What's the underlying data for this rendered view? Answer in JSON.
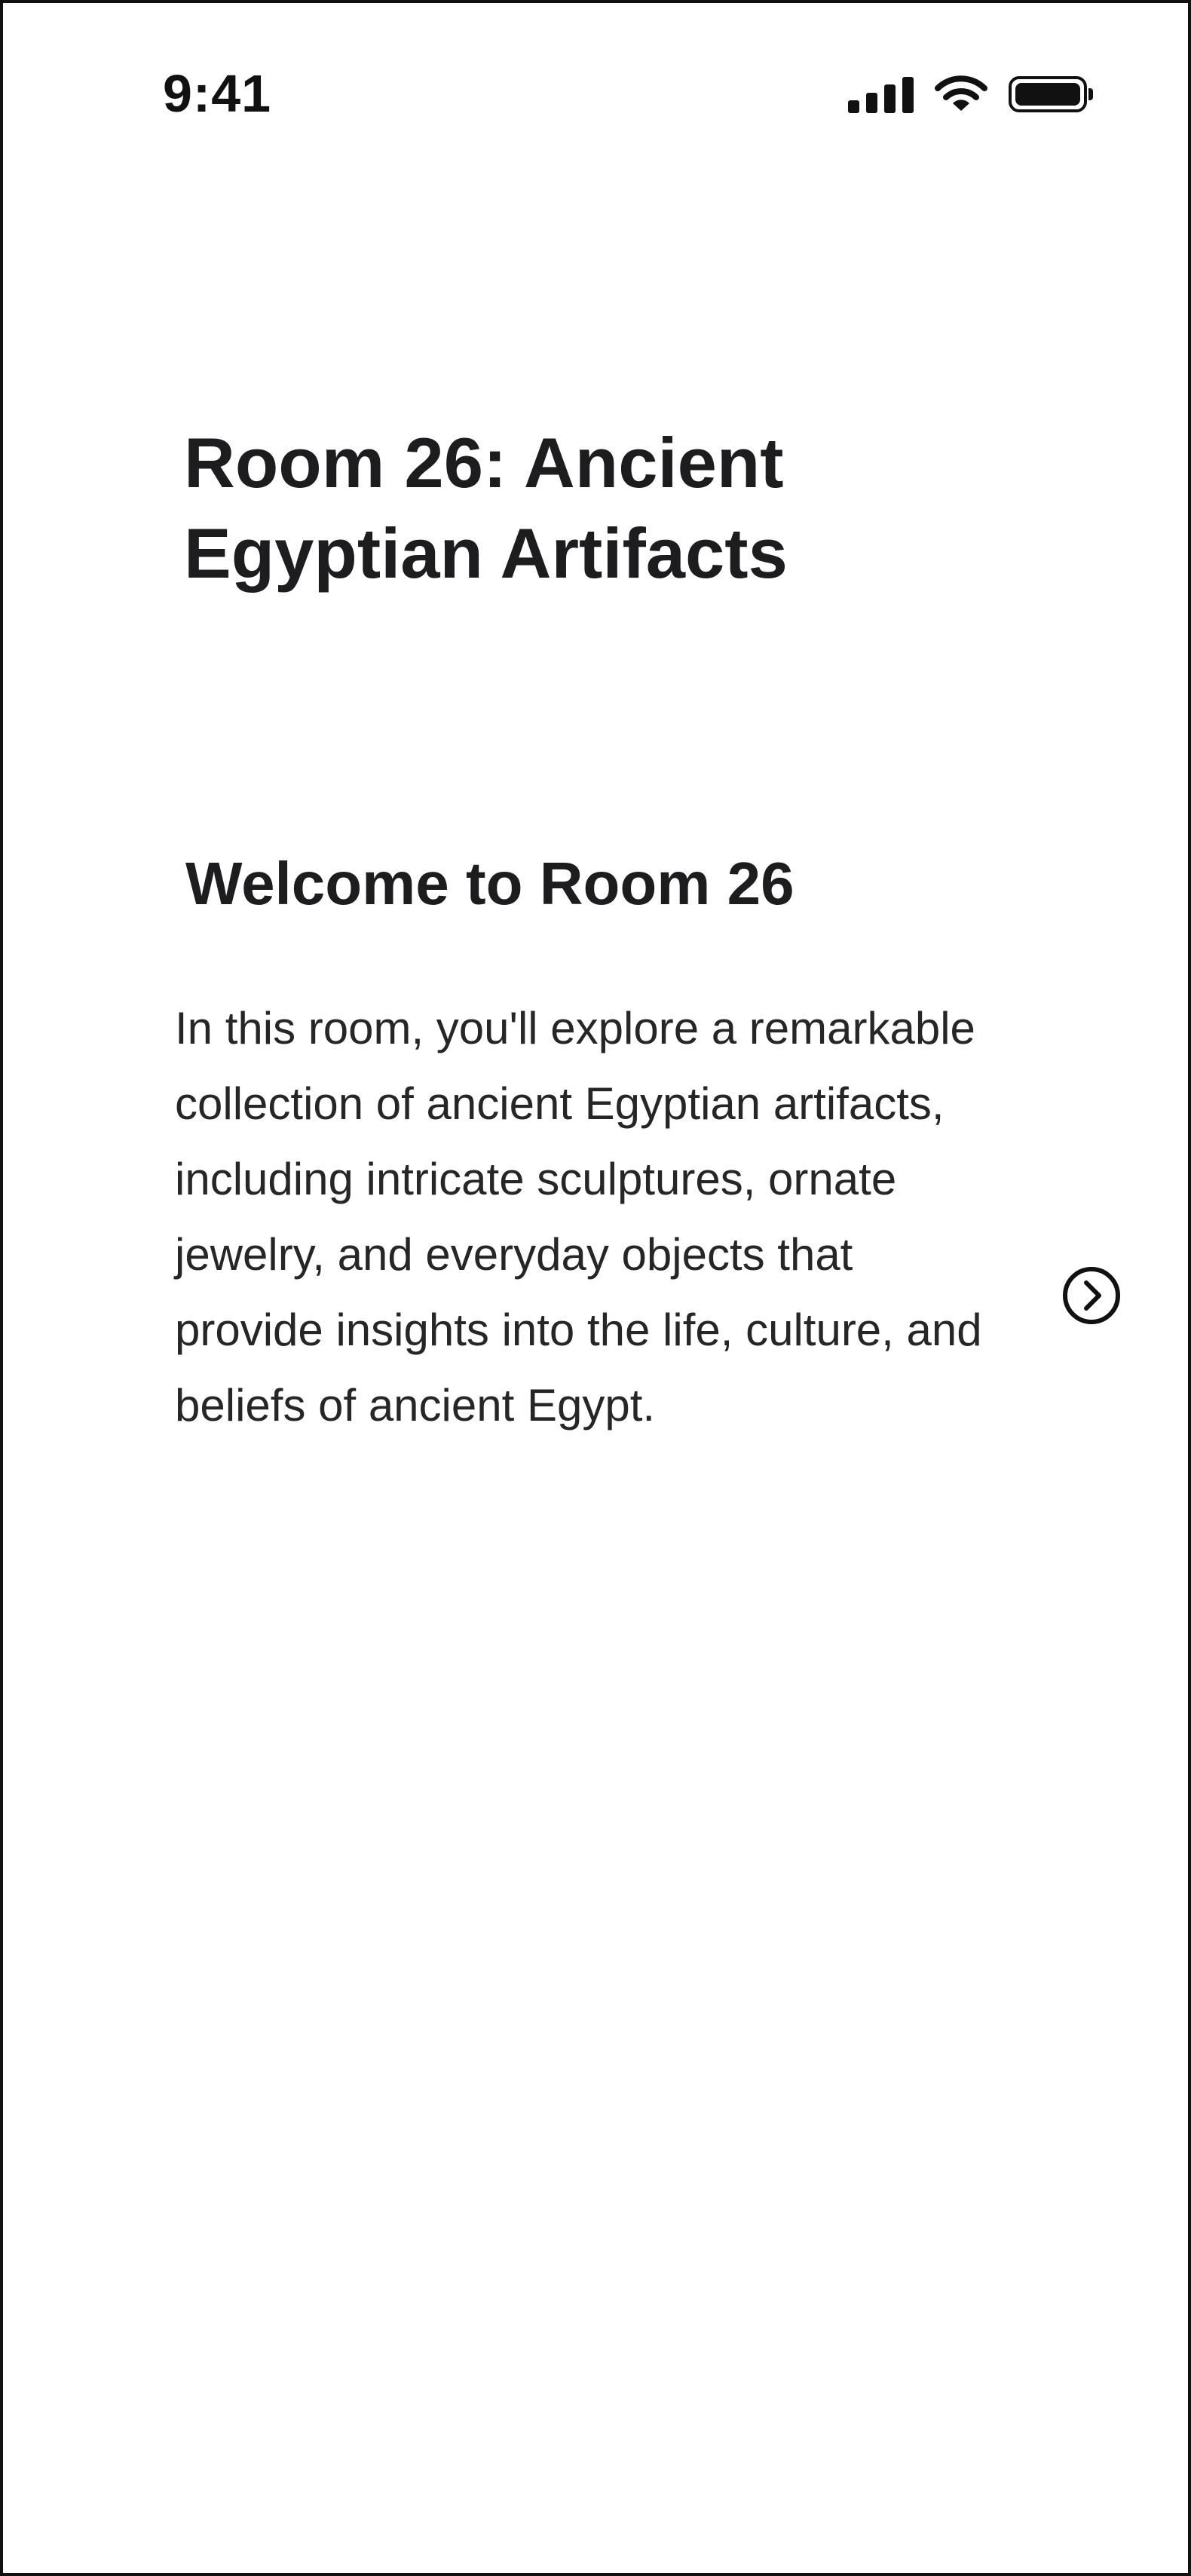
{
  "status_bar": {
    "time": "9:41",
    "icons": [
      "cellular-signal-icon",
      "wifi-icon",
      "battery-icon"
    ]
  },
  "page": {
    "title": "Room 26: Ancient Egyptian Artifacts"
  },
  "section": {
    "heading": "Welcome to Room 26",
    "body": "In this room, you'll explore a remarkable collection of ancient Egyptian artifacts, including intricate sculptures, ornate jewelry, and everyday objects that provide insights into the life, culture, and beliefs of ancient Egypt."
  },
  "controls": {
    "next_icon": "chevron-right-circle-icon"
  },
  "colors": {
    "background": "#ffffff",
    "text": "#1d1d1f",
    "icon": "#111111"
  }
}
